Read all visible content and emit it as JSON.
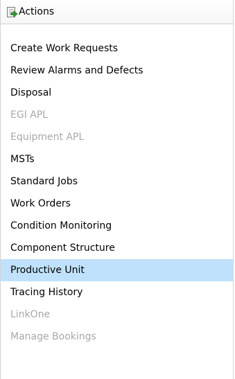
{
  "panel": {
    "title": "Actions",
    "icon": "actions-icon"
  },
  "menu": {
    "items": [
      {
        "label": "Create Work Requests",
        "state": "enabled"
      },
      {
        "label": "Review Alarms and Defects",
        "state": "enabled"
      },
      {
        "label": "Disposal",
        "state": "enabled"
      },
      {
        "label": "EGI APL",
        "state": "disabled"
      },
      {
        "label": "Equipment APL",
        "state": "disabled"
      },
      {
        "label": "MSTs",
        "state": "enabled"
      },
      {
        "label": "Standard Jobs",
        "state": "enabled"
      },
      {
        "label": "Work Orders",
        "state": "enabled"
      },
      {
        "label": "Condition Monitoring",
        "state": "enabled"
      },
      {
        "label": "Component Structure",
        "state": "enabled"
      },
      {
        "label": "Productive Unit",
        "state": "selected"
      },
      {
        "label": "Tracing History",
        "state": "enabled"
      },
      {
        "label": "LinkOne",
        "state": "disabled"
      },
      {
        "label": "Manage Bookings",
        "state": "disabled"
      }
    ]
  },
  "colors": {
    "selected_background": "#bfe1fb",
    "disabled_text": "#a8a8a8",
    "icon_green": "#2f9b2f",
    "icon_page": "#f4f4f4"
  }
}
